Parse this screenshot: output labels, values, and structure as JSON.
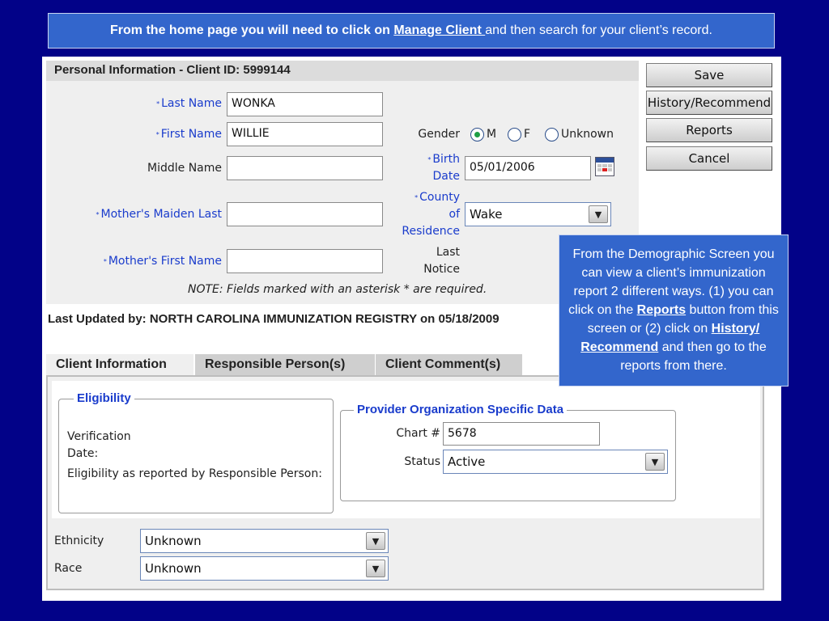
{
  "banner": {
    "part1": "From the home page you will need to click on ",
    "link": "Manage Client ",
    "part2": "and then search for your client’s record."
  },
  "form": {
    "header": "Personal Information - Client ID: 5999144",
    "last_name_label": "Last Name",
    "last_name_value": "WONKA",
    "first_name_label": "First Name",
    "first_name_value": "WILLIE",
    "middle_name_label": "Middle Name",
    "middle_name_value": "",
    "mothers_maiden_label": "Mother's Maiden Last",
    "mothers_maiden_value": "",
    "mothers_first_label": "Mother's First Name",
    "mothers_first_value": "",
    "gender_label": "Gender",
    "gender_options": [
      "M",
      "F",
      "Unknown"
    ],
    "gender_selected": "M",
    "birth_date_label_1": "Birth",
    "birth_date_label_2": "Date",
    "birth_date_value": "05/01/2006",
    "county_label_1": "County",
    "county_label_2": "of",
    "county_label_3": "Residence",
    "county_value": "Wake",
    "last_notice_label_1": "Last",
    "last_notice_label_2": "Notice",
    "required_star": "*",
    "note": "NOTE: Fields marked with an asterisk * are required."
  },
  "buttons": {
    "save": "Save",
    "history": "History/Recommend",
    "reports": "Reports",
    "cancel": "Cancel"
  },
  "last_updated": "Last Updated by: NORTH CAROLINA IMMUNIZATION REGISTRY on 05/18/2009",
  "tabs": [
    "Client Information",
    "Responsible Person(s)",
    "Client Comment(s)"
  ],
  "eligibility": {
    "legend": "Eligibility",
    "verification_label_1": "Verification",
    "verification_label_2": "Date:",
    "reported_label": "Eligibility as reported by Responsible Person:"
  },
  "provider": {
    "legend": "Provider Organization Specific Data",
    "chart_label": "Chart #",
    "chart_value": "5678",
    "status_label": "Status",
    "status_value": "Active"
  },
  "demographics": {
    "ethnicity_label": "Ethnicity",
    "ethnicity_value": "Unknown",
    "race_label": "Race",
    "race_value": "Unknown"
  },
  "callout": {
    "text1": "From the Demographic Screen you can view a client’s immunization report  2 different ways. (1) you can click on the ",
    "reports": "Reports",
    "text2": " button from this screen or (2) click on ",
    "history": "History/ Recommend",
    "text3": " and then go to the reports from there."
  },
  "icons": {
    "calendar": "calendar-icon",
    "dropdown": "chevron-down-icon"
  },
  "colors": {
    "background": "#020288",
    "banner": "#3366cc",
    "required_label": "#1a3ccc",
    "radio_selected": "#1f9e44"
  }
}
